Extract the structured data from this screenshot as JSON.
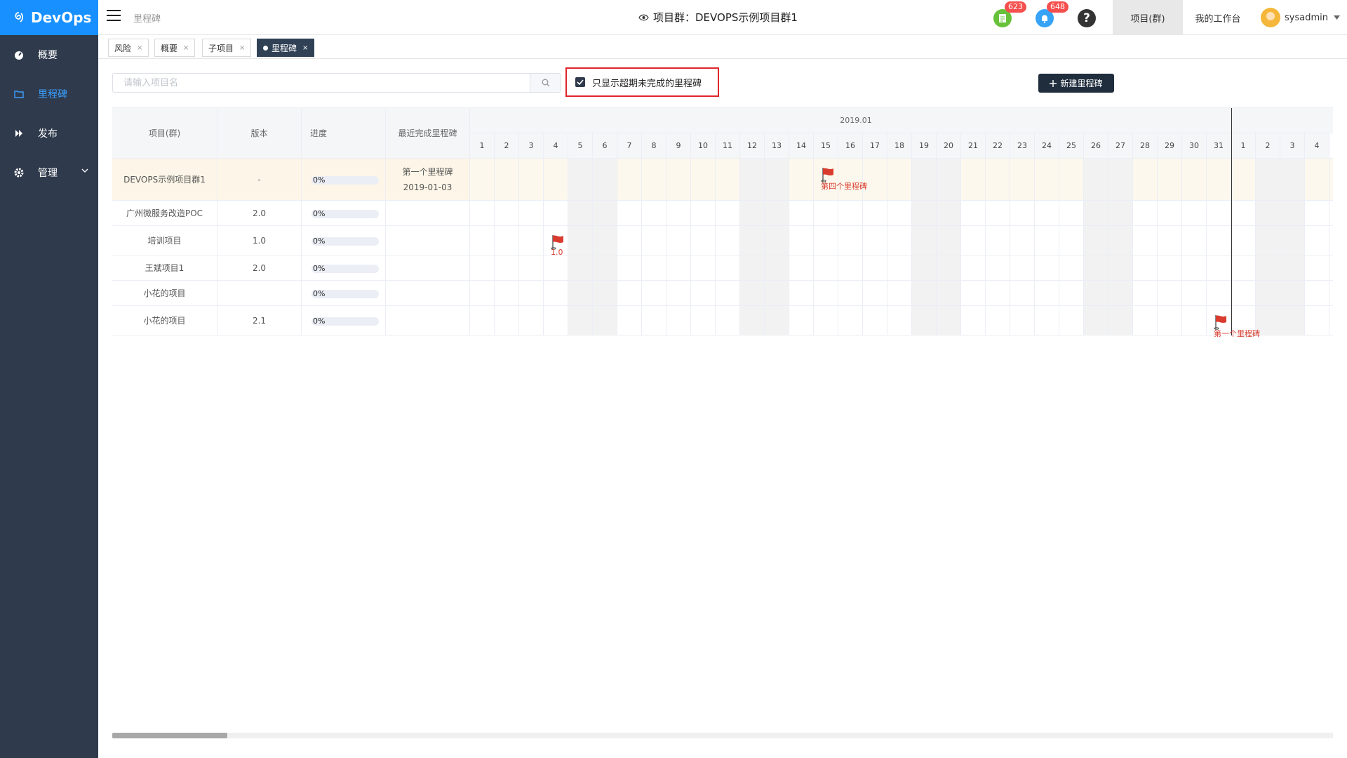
{
  "app": {
    "logo_text": "DevOps"
  },
  "sidebar": {
    "items": [
      {
        "label": "概要",
        "icon": "dashboard-icon"
      },
      {
        "label": "里程碑",
        "icon": "folder-icon"
      },
      {
        "label": "发布",
        "icon": "forward-icon"
      },
      {
        "label": "管理",
        "icon": "gear-icon"
      }
    ]
  },
  "header": {
    "breadcrumb": "里程碑",
    "project_title": "项目群：DEVOPS示例项目群1",
    "badge_docs": "623",
    "badge_notify": "648",
    "tab_project": "项目(群)",
    "tab_workbench": "我的工作台",
    "username": "sysadmin"
  },
  "tabs": [
    {
      "label": "风险"
    },
    {
      "label": "概要"
    },
    {
      "label": "子项目"
    },
    {
      "label": "里程碑"
    }
  ],
  "toolbar": {
    "search_placeholder": "请输入项目名",
    "filter_label": "只显示超期未完成的里程碑",
    "filter_checked": true,
    "new_button": "新建里程碑"
  },
  "table": {
    "headers": {
      "project": "项目(群)",
      "version": "版本",
      "progress": "进度",
      "recent": "最近完成里程碑"
    },
    "rows": [
      {
        "project": "DEVOPS示例项目群1",
        "version": "-",
        "progress": "0%",
        "recent": "第一个里程碑",
        "recent_date": "2019-01-03"
      },
      {
        "project": "广州微服务改造POC",
        "version": "2.0",
        "progress": "0%",
        "recent": "",
        "recent_date": ""
      },
      {
        "project": "培训项目",
        "version": "1.0",
        "progress": "0%",
        "recent": "",
        "recent_date": ""
      },
      {
        "project": "王斌项目1",
        "version": "2.0",
        "progress": "0%",
        "recent": "",
        "recent_date": ""
      },
      {
        "project": "小花的项目",
        "version": "",
        "progress": "0%",
        "recent": "",
        "recent_date": ""
      },
      {
        "project": "小花的项目",
        "version": "2.1",
        "progress": "0%",
        "recent": "",
        "recent_date": ""
      }
    ]
  },
  "calendar": {
    "month": "2019.01",
    "days": [
      "1",
      "2",
      "3",
      "4",
      "5",
      "6",
      "7",
      "8",
      "9",
      "10",
      "11",
      "12",
      "13",
      "14",
      "15",
      "16",
      "17",
      "18",
      "19",
      "20",
      "21",
      "22",
      "23",
      "24",
      "25",
      "26",
      "27",
      "28",
      "29",
      "30",
      "31",
      "1",
      "2",
      "3",
      "4"
    ],
    "weekends": [
      "5",
      "6",
      "12",
      "13",
      "19",
      "20",
      "26",
      "27",
      "2",
      "3"
    ],
    "today_after": "31"
  },
  "milestones": [
    {
      "row": 0,
      "day": "15",
      "label": "第四个里程碑"
    },
    {
      "row": 2,
      "day": "4",
      "label": "1.0"
    },
    {
      "row": 5,
      "day": "31",
      "label": "第一个里程碑"
    }
  ],
  "colors": {
    "accent": "#1890ff",
    "sidebar": "#2f3a4d",
    "flag": "#d93b2e",
    "highlight_row": "#fdf6e8",
    "weekend": "#f2f2f2"
  }
}
